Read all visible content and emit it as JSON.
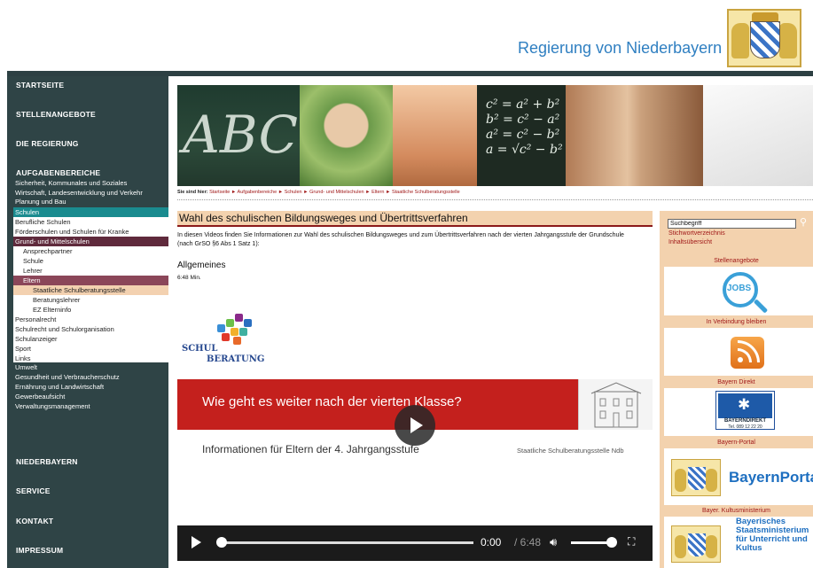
{
  "header": {
    "gov_name": "Regierung von Niederbayern"
  },
  "sidebar": {
    "startseite": "STARTSEITE",
    "stellenangebote": "STELLENANGEBOTE",
    "regierung": "DIE REGIERUNG",
    "aufgabenbereiche": "AUFGABENBEREICHE",
    "items": [
      "Sicherheit, Kommunales und Soziales",
      "Wirtschaft, Landesentwicklung und Verkehr",
      "Planung und Bau",
      "Schulen",
      "Berufliche Schulen",
      "Förderschulen und Schulen für Kranke",
      "Grund- und Mittelschulen",
      "Ansprechpartner",
      "Schule",
      "Lehrer",
      "Eltern",
      "Staatliche Schulberatungsstelle",
      "Beratungslehrer",
      "EZ Elterninfo",
      "Personalrecht",
      "Schulrecht und Schulorganisation",
      "Schulanzeiger",
      "Sport",
      "Links",
      "Umwelt",
      "Gesundheit und Verbraucherschutz",
      "Ernährung und Landwirtschaft",
      "Gewerbeaufsicht",
      "Verwaltungsmanagement"
    ],
    "niederbayern": "NIEDERBAYERN",
    "service": "SERVICE",
    "kontakt": "KONTAKT",
    "impressum": "IMPRESSUM"
  },
  "breadcrumb": {
    "label": "Sie sind hier:",
    "items": [
      "Startseite",
      "Aufgabenbereiche",
      "Schulen",
      "Grund- und Mittelschulen",
      "Eltern",
      "Staatliche Schulberatungsstelle"
    ],
    "separator": "►"
  },
  "main": {
    "title": "Wahl des schulischen Bildungsweges und Übertrittsverfahren",
    "intro": "In diesen Videos finden Sie Informationen zur Wahl des schulischen Bildungsweges und zum Übertrittsverfahren nach der vierten Jahrgangsstufe der Grundschule (nach GrSO §6 Abs 1 Satz 1):",
    "section_heading": "Allgemeines",
    "duration": "6:48 Min.",
    "logo_line1": "SCHUL",
    "logo_line2": "BERATUNG"
  },
  "video": {
    "title": "Wie geht es weiter nach der vierten Klasse?",
    "subtitle": "Informationen für Eltern der 4. Jahrgangsstufe",
    "org": "Staatliche Schulberatungsstelle Ndb",
    "time_current": "0:00",
    "time_total": "/ 6:48",
    "progress": 0.0,
    "volume": 1.0
  },
  "right": {
    "search_value": "Suchbegriff",
    "links": [
      "Stichwortverzeichnis",
      "Inhaltsübersicht"
    ],
    "stellen_head": "Stellenangebote",
    "jobs_label": "JOBS",
    "verbindung_head": "In Verbindung bleiben",
    "bayern_direkt_head": "Bayern Direkt",
    "bd_name": "BAYERNDIREKT",
    "bd_tel": "Tel. 089 12 22 20",
    "portal_head": "Bayern-Portal",
    "portal_text": "BayernPortal",
    "km_head": "Bayer. Kultusministerium",
    "km_text": "Bayerisches Staatsministerium für Unterricht und Kultus"
  },
  "colors": {
    "sidebar_bg": "#2f4446",
    "accent_red": "#a01818",
    "peach": "#f3d2ae",
    "teal": "#1a8b8f",
    "video_red": "#c4201d"
  }
}
